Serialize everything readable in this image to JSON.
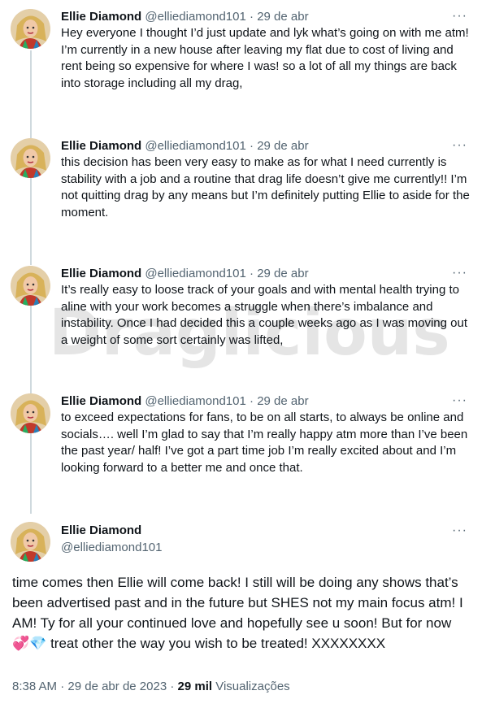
{
  "tweets": [
    {
      "name": "Ellie Diamond",
      "handle": "@elliediamond101",
      "sep": "·",
      "date": "29 de abr",
      "text": "Hey everyone I thought I’d just update and lyk what’s going on with me atm! I’m currently in a new house after leaving my flat due to cost of living and rent being so expensive for where I was! so a lot of all my things are back into storage including all my drag,"
    },
    {
      "name": "Ellie Diamond",
      "handle": "@elliediamond101",
      "sep": "·",
      "date": "29 de abr",
      "text": "this decision has been very easy to make as for what I need currently is stability with a job and a routine that drag life doesn’t give me currently!! I’m not quitting drag by any means but I’m definitely putting Ellie to aside for the moment."
    },
    {
      "name": "Ellie Diamond",
      "handle": "@elliediamond101",
      "sep": "·",
      "date": "29 de abr",
      "text": "It’s really easy to loose track of your goals and with mental health trying to aline with your work becomes a struggle when there’s imbalance and instability. Once I had decided this a couple weeks ago as I was moving out a weight of some sort certainly was lifted,"
    },
    {
      "name": "Ellie Diamond",
      "handle": "@elliediamond101",
      "sep": "·",
      "date": "29 de abr",
      "text": "to exceed expectations for fans, to be on all starts, to always be online and socials…. well I’m glad to say that I’m really happy atm more than I’ve been the past year/ half! I’ve got a part time job I’m really excited about and I’m looking forward to a better me and once that."
    }
  ],
  "main_tweet": {
    "name": "Ellie Diamond",
    "handle": "@elliediamond101",
    "text": "time comes then Ellie will come back! I still will be doing any shows that’s been advertised past and in the future but SHES not my main focus atm! I AM! Ty for all your continued love and hopefully see u soon! But for now",
    "emoji": "💞💎",
    "text_end": " treat other the way you wish to be treated! XXXXXXXX",
    "time": "8:38 AM",
    "sep": "·",
    "date": "29 de abr de 2023",
    "views_count": "29 mil",
    "views_label": "Visualizações"
  },
  "more_label": "···",
  "watermark": "Draglicious",
  "colors": {
    "text": "#0f1419",
    "secondary": "#536471",
    "thread_line": "#cfd9de"
  }
}
